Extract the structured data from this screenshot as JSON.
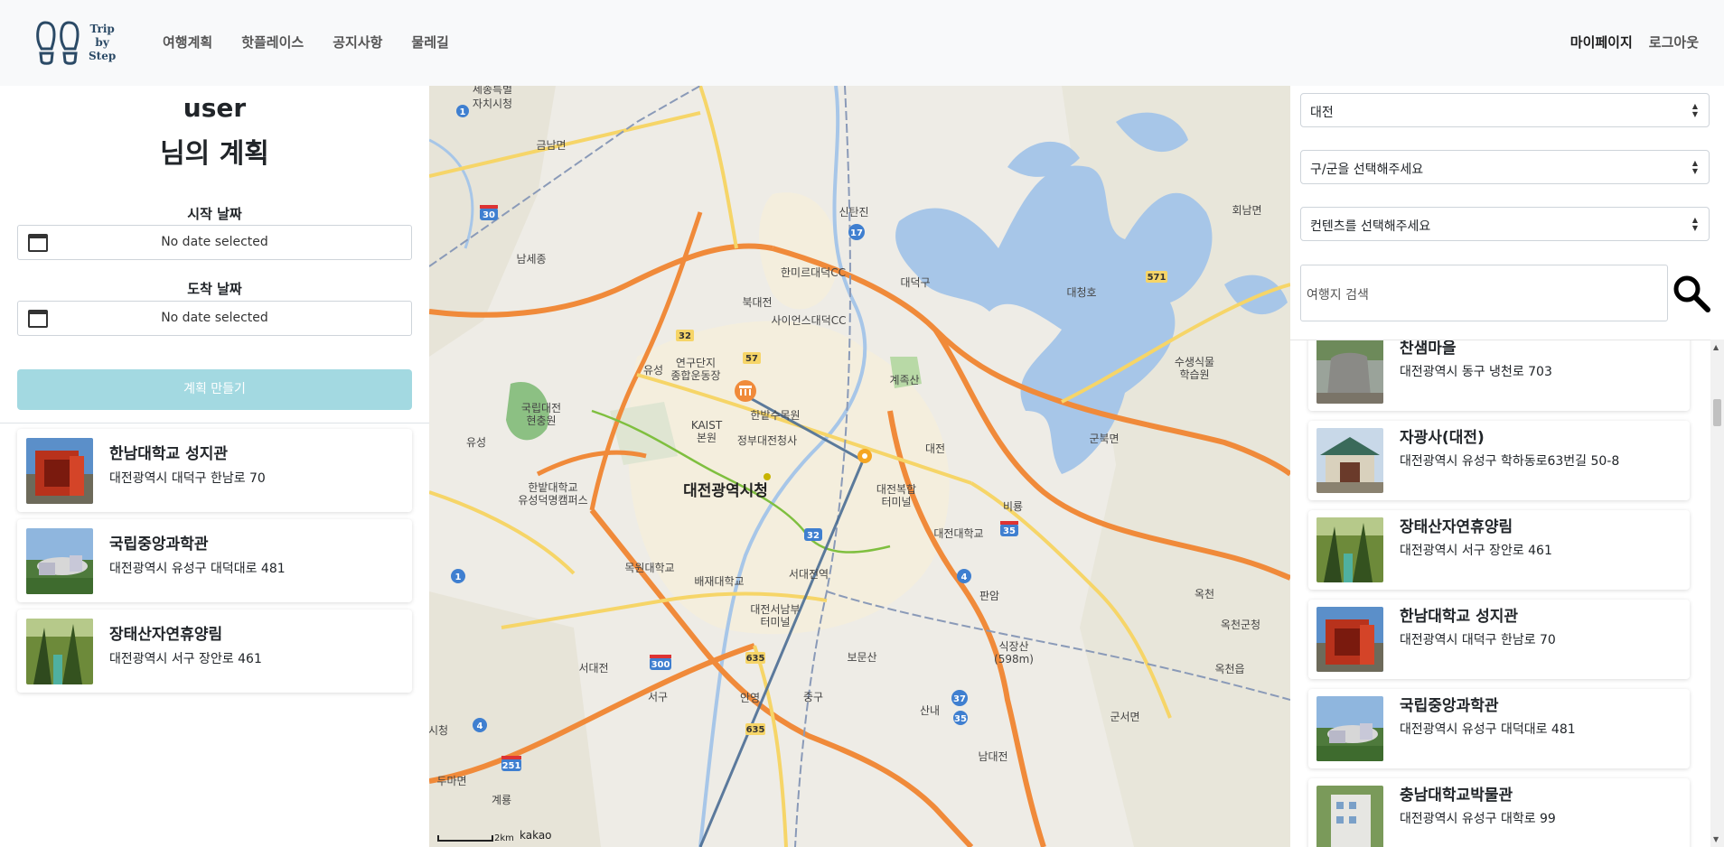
{
  "header": {
    "brand_lines": [
      "Trip",
      "by",
      "Step"
    ],
    "nav": [
      {
        "label": "여행계획"
      },
      {
        "label": "핫플레이스"
      },
      {
        "label": "공지사항"
      },
      {
        "label": "물레길"
      }
    ],
    "mypage_label": "마이페이지",
    "logout_label": "로그아웃"
  },
  "left": {
    "user_name": "user",
    "user_suffix": "님의 계획",
    "start_label": "시작 날짜",
    "end_label": "도착 날짜",
    "start_value": "No date selected",
    "end_value": "No date selected",
    "plan_button": "계획 만들기",
    "plans": [
      {
        "title": "한남대학교 성지관",
        "addr": "대전광역시 대덕구 한남로 70"
      },
      {
        "title": "국립중앙과학관",
        "addr": "대전광역시 유성구 대덕대로 481"
      },
      {
        "title": "장태산자연휴양림",
        "addr": "대전광역시 서구 장안로 461"
      }
    ]
  },
  "map": {
    "labels": {
      "city_hall": "대전광역시청",
      "sejong": "세종특별",
      "sejong2": "자치시청",
      "geumnam": "금남면",
      "namsejong": "남세종",
      "sintanjin": "신탄진",
      "hanmiru": "한미르대덕CC",
      "bukdaejeon": "북대전",
      "science_cc": "사이언스대덕CC",
      "daedeokgu": "대덕구",
      "daecheongho": "대청호",
      "hoenam": "회남면",
      "susin": "수생식물",
      "susin2": "학습원",
      "yeongu": "연구단지",
      "yeongu2": "종합운동장",
      "yuseong_ic": "유성",
      "kaist": "KAIST",
      "kaist2": "본원",
      "arboretum": "한밭수목원",
      "gov": "정부대전청사",
      "natl_forest": "국립대전",
      "natl_forest2": "현충원",
      "gyejoksan": "계족산",
      "daejeon_ic": "대전",
      "gunbuk": "군북면",
      "hanbat_univ": "한밭대학교",
      "hanbat_univ2": "유성덕명캠퍼스",
      "bokhap": "대전복합",
      "bokhap2": "터미널",
      "biryong": "비룡",
      "daejeon_univ": "대전대학교",
      "mokwon": "목원대학교",
      "paichai": "배재대학교",
      "seodaejeon": "서대전역",
      "seonambu": "대전서남부",
      "seonambu2": "터미널",
      "panam": "판암",
      "okcheon": "옥천",
      "okcheongun": "옥천군청",
      "seodaejeon_ic": "서대전",
      "bomunsan": "보문산",
      "sikjangsan": "식장산",
      "sikjangsan2": "(598m)",
      "okcheoneup": "옥천읍",
      "seogu": "서구",
      "jung": "중구",
      "anyeong": "안영",
      "sannae": "산내",
      "gunseomyeon": "군서면",
      "namdaejeon": "남대전",
      "dumamyeon": "두마면",
      "gyeryong": "계룡",
      "si": "시청",
      "scale": "2km",
      "kakao": "kakao",
      "road_1": "1",
      "road_30": "30",
      "road_17": "17",
      "road_32": "32",
      "road_57": "57",
      "road_571": "571",
      "road_35": "35",
      "road_4": "4",
      "road_300": "300",
      "road_635": "635",
      "road_251": "251",
      "road_37": "37"
    }
  },
  "right": {
    "region_select": "대전",
    "district_select": "구/군을 선택해주세요",
    "content_select": "컨텐츠를 선택해주세요",
    "search_placeholder": "여행지 검색",
    "results": [
      {
        "title": "찬샘마을",
        "addr": "대전광역시 동구 냉천로 703"
      },
      {
        "title": "자광사(대전)",
        "addr": "대전광역시 유성구 학하동로63번길 50-8"
      },
      {
        "title": "장태산자연휴양림",
        "addr": "대전광역시 서구 장안로 461"
      },
      {
        "title": "한남대학교 성지관",
        "addr": "대전광역시 대덕구 한남로 70"
      },
      {
        "title": "국립중앙과학관",
        "addr": "대전광역시 유성구 대덕대로 481"
      },
      {
        "title": "충남대학교박물관",
        "addr": "대전광역시 유성구 대학로 99"
      }
    ]
  },
  "colors": {
    "accent_button": "#a3d9e1",
    "route_line": "#4a6d94",
    "highway": "#f08a3a",
    "water": "#a7c6e8",
    "navbar_bg": "#f8f9fa"
  }
}
